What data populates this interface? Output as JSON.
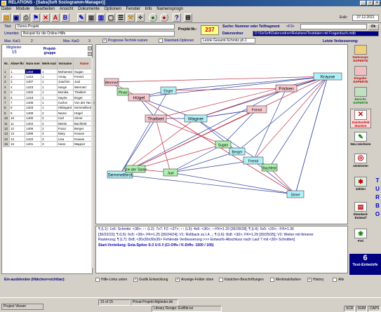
{
  "window": {
    "title": "RELATIONS - [Sabs(Soft Soziogramm-Manager)]"
  },
  "menu": [
    "Datei",
    "Module",
    "Bearbeiten",
    "Ansicht",
    "Dokumente",
    "Optionen",
    "Fenster",
    "Info",
    "Namensprogn"
  ],
  "toolbar": {
    "date": "27.12.2021",
    "er_label": "Er&t:"
  },
  "header": {
    "titel_label": "Titel:",
    "titel_value": "Demo-Projekt",
    "untertitel_label": "Untertitel:",
    "untertitel_value": "Beispiel für die Online-Hilfe",
    "projekt_nr_label": "Projekt-Nr.:",
    "projekt_nr_value": "237",
    "suche_label": "Suche: Nummer oder Teilfragment",
    "suche_hint": "<F3>",
    "datenordner_label": "Datenordner",
    "datenordner_value": "D:\\SixSoft\\Datenordner\\Relations\\Testdaten mit Fragenbuch.mdb",
    "max_kat1_label": "Max. Kat1:",
    "max_kat1_value": "2",
    "max_kat2_label": "Max. Kat2:",
    "max_kat2_value": "3",
    "prognose_label": "Prognose-Technik nutzen",
    "standard_label": "Standard-Optionen",
    "letzte_value": "Letzte Gesamt-Schmitz ph.1",
    "letzte_verbesserung_label": "Letzte Verbesserung:"
  },
  "left_panel": {
    "mitglieder_label": "Mitglieder",
    "mitglieder_value": "15",
    "projektgruppe_label": "Projekt-gruppe",
    "columns": [
      "Nr.",
      "Abwe-fkr",
      "Num-mer",
      "Merk-mal",
      "Vorname",
      "Name"
    ],
    "rows": [
      [
        "1",
        "1",
        "1458",
        "1",
        "Mohamed",
        "Sugan"
      ],
      [
        "2",
        "2",
        "1410",
        "1",
        "Amay",
        "Fremd"
      ],
      [
        "3",
        "3",
        "1407",
        "1",
        "Joachim",
        "Juul"
      ],
      [
        "4",
        "4",
        "1423",
        "1",
        "Harge",
        "Wermert"
      ],
      [
        "5",
        "5",
        "1402",
        "1",
        "Monika",
        "Thaibert"
      ],
      [
        "6",
        "6",
        "1419",
        "1",
        "Sayrie",
        "Enger"
      ],
      [
        "7",
        "7",
        "1405",
        "1",
        "Carlos",
        "Von der Tanne"
      ],
      [
        "8",
        "8",
        "1403",
        "1",
        "Hildegard",
        "Semmelbrot"
      ],
      [
        "9",
        "9",
        "1408",
        "2",
        "Name",
        "Hügel"
      ],
      [
        "10",
        "10",
        "1400",
        "2",
        "Carl",
        "Sirner"
      ],
      [
        "11",
        "11",
        "1404",
        "2",
        "Mertin",
        "Bachfeld"
      ],
      [
        "12",
        "12",
        "1406",
        "2",
        "Franz",
        "Berger"
      ],
      [
        "13",
        "13",
        "1399",
        "3",
        "Mary",
        "Krause"
      ],
      [
        "14",
        "14",
        "1422",
        "3",
        "Lisa",
        "Krause"
      ],
      [
        "15",
        "15",
        "1401",
        "3",
        "Hans",
        "Wagner"
      ]
    ],
    "footer_label": "Ein-ausblenden (Häkchen=sichtbar):"
  },
  "diagram_nodes": [
    {
      "label": "Krause",
      "color": "#b0f0f8"
    },
    {
      "label": "Fremd",
      "color": "#f8c8d0"
    },
    {
      "label": "Enger",
      "color": "#b0f0f8"
    },
    {
      "label": "Fricken",
      "color": "#f8c8d0"
    },
    {
      "label": "Hügel",
      "color": "#f8c8d0"
    },
    {
      "label": "Thaibert",
      "color": "#f8c8d0"
    },
    {
      "label": "Wagner",
      "color": "#b0f0f8"
    },
    {
      "label": "Fremd",
      "color": "#b0f0f8"
    },
    {
      "label": "Berger",
      "color": "#b0f0f8"
    },
    {
      "label": "Sugan",
      "color": "#b0f0b0"
    },
    {
      "label": "Semmelbrot",
      "color": "#b0f0f8"
    },
    {
      "label": "Von der Tanne",
      "color": "#b0f0b0"
    },
    {
      "label": "Juul",
      "color": "#b0f0b0"
    },
    {
      "label": "Sirner",
      "color": "#b0f0f8"
    },
    {
      "label": "Wermert",
      "color": "#f8c8d0"
    },
    {
      "label": "Pinan",
      "color": "#b0f0b0"
    },
    {
      "label": "Bachfeld",
      "color": "#b0f0b0"
    }
  ],
  "status": {
    "line1": "¶ (L1): 1x6: Schmitz: <38>; ↑↑ (L2): 7x7; F2: <37>; ↑↑ (L3): 4x6: <36>; ↑↑FK=1.29 [36/28/28]; ¶ (L4): 5x5: <20>; ↑FK=1.36",
    "line2": "[30/22/22]; ¶ (L5): 6x5: <39>; FK=1.25 [30/24/24]; V1: Rollback zu L4...; ¶ (L6): 8x8: <30>; FK=1.29 [30/25/25]; V2: Weiter mit feinerer",
    "line3": "Rasterung; ¶ (L7): 8x8; <30x30x30x30> Fehlende Verbesserung >>> Entwurfs-Abschluss nach Lauf 7 mit <30> Schnitten]",
    "line4": "Start-Verteilung: Sola-Spitze S:3 U:5 //  (Cl-Offs / K-Diffs: 1500 / 105)"
  },
  "checkboxes": [
    {
      "label": "Hilfe-Links unten",
      "checked": false
    },
    {
      "label": "Grafik Entwicklung",
      "checked": true
    },
    {
      "label": "Anzeige-Felder oben",
      "checked": true
    },
    {
      "label": "Kästchen-Beschriftungen",
      "checked": false
    },
    {
      "label": "Merkmalsfarben",
      "checked": false
    },
    {
      "label": "History",
      "checked": true
    },
    {
      "label": "Alle",
      "checked": false
    }
  ],
  "right_panel": [
    {
      "label": "Datenexpr. EXPERTE",
      "icon": "data-expert-icon"
    },
    {
      "label": "Eingabe-EXPERTE",
      "icon": "input-expert-icon"
    },
    {
      "label": "Bericht-EXPERTE",
      "icon": "report-expert-icon"
    },
    {
      "label": "Zeichenfeld löschen",
      "icon": "clear-canvas-icon"
    },
    {
      "label": "Neu zeichnen",
      "icon": "redraw-icon"
    },
    {
      "label": "zentrieren",
      "icon": "center-icon"
    },
    {
      "label": "zählen",
      "icon": "count-icon"
    },
    {
      "label": "Standard-Entwurf",
      "icon": "standard-draft-icon"
    },
    {
      "label": "Frei",
      "icon": "free-icon"
    }
  ],
  "turbo_label": "TURBO",
  "test_cards": {
    "count": "6",
    "label": "Test-Entwürfe"
  },
  "statusbar": {
    "tab_label": "Project Viewer",
    "page_info": "15 of 15",
    "db_info": "Privat Projekt-Mglieder.db",
    "library": "Library Design: ExtBib.txt",
    "keys": [
      "SCR",
      "NUM",
      "CAPS"
    ]
  }
}
